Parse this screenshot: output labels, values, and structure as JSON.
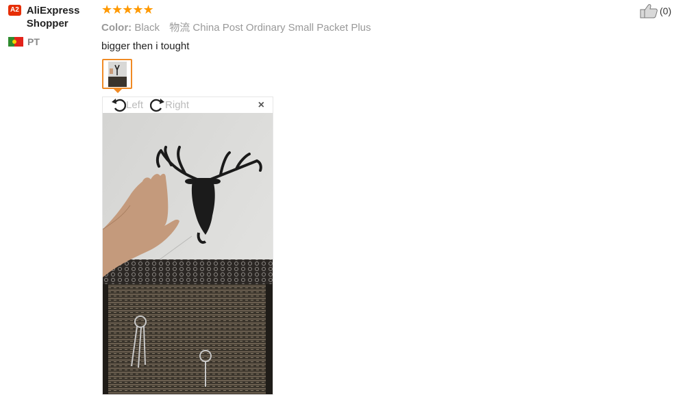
{
  "user": {
    "level_badge": "A2",
    "name": "AliExpress Shopper",
    "country_code": "PT"
  },
  "review": {
    "rating": 5,
    "stars_text": "★★★★★",
    "color_label": "Color:",
    "color_value": "Black",
    "shipping_label": "物流",
    "shipping_value": "China Post Ordinary Small Packet Plus",
    "text": "bigger then i tought"
  },
  "viewer": {
    "rotate_left_label": "Left",
    "rotate_right_label": "Right",
    "close_label": "×"
  },
  "like": {
    "count_text": "(0)"
  },
  "colors": {
    "badge": "#e62e04",
    "stars": "#ff9900",
    "thumb_border": "#f08a24"
  },
  "icons": {
    "thumbs_up": "thumbs-up-icon",
    "rotate_left": "rotate-left-icon",
    "rotate_right": "rotate-right-icon",
    "flag": "portugal-flag-icon"
  }
}
